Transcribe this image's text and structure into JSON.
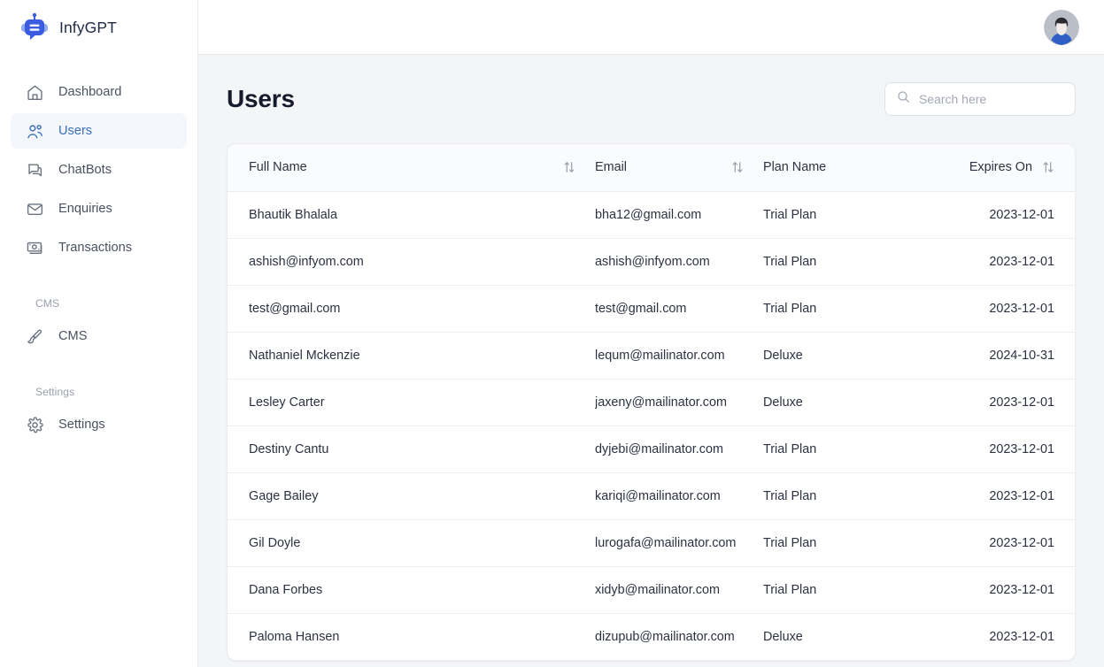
{
  "brand": {
    "name": "InfyGPT",
    "logo_icon": "chatbot-logo-icon",
    "accent": "#3a6fbe",
    "logo_color": "#3b5ce0"
  },
  "sidebar": {
    "items": [
      {
        "label": "Dashboard",
        "icon": "home-icon",
        "active": false
      },
      {
        "label": "Users",
        "icon": "users-icon",
        "active": true
      },
      {
        "label": "ChatBots",
        "icon": "chat-bubbles-icon",
        "active": false
      },
      {
        "label": "Enquiries",
        "icon": "envelope-icon",
        "active": false
      },
      {
        "label": "Transactions",
        "icon": "banknote-icon",
        "active": false
      }
    ],
    "sections": [
      {
        "label": "CMS",
        "items": [
          {
            "label": "CMS",
            "icon": "paintbrush-icon",
            "active": false
          }
        ]
      },
      {
        "label": "Settings",
        "items": [
          {
            "label": "Settings",
            "icon": "gear-icon",
            "active": false
          }
        ]
      }
    ]
  },
  "topbar": {
    "avatar_icon": "user-avatar-icon"
  },
  "page": {
    "title": "Users"
  },
  "search": {
    "placeholder": "Search here",
    "value": "",
    "icon": "search-icon"
  },
  "table": {
    "columns": [
      {
        "label": "Full Name",
        "sortable": true,
        "sort_icon": "sort-arrows-icon",
        "align": "left"
      },
      {
        "label": "Email",
        "sortable": true,
        "sort_icon": "sort-arrows-icon",
        "align": "left"
      },
      {
        "label": "Plan Name",
        "sortable": false,
        "align": "left"
      },
      {
        "label": "Expires On",
        "sortable": true,
        "sort_icon": "sort-arrows-icon",
        "align": "right"
      }
    ],
    "rows": [
      {
        "full_name": "Bhautik Bhalala",
        "email": "bha12@gmail.com",
        "plan_name": "Trial Plan",
        "expires_on": "2023-12-01"
      },
      {
        "full_name": "ashish@infyom.com",
        "email": "ashish@infyom.com",
        "plan_name": "Trial Plan",
        "expires_on": "2023-12-01"
      },
      {
        "full_name": "test@gmail.com",
        "email": "test@gmail.com",
        "plan_name": "Trial Plan",
        "expires_on": "2023-12-01"
      },
      {
        "full_name": "Nathaniel Mckenzie",
        "email": "lequm@mailinator.com",
        "plan_name": "Deluxe",
        "expires_on": "2024-10-31"
      },
      {
        "full_name": "Lesley Carter",
        "email": "jaxeny@mailinator.com",
        "plan_name": "Deluxe",
        "expires_on": "2023-12-01"
      },
      {
        "full_name": "Destiny Cantu",
        "email": "dyjebi@mailinator.com",
        "plan_name": "Trial Plan",
        "expires_on": "2023-12-01"
      },
      {
        "full_name": "Gage Bailey",
        "email": "kariqi@mailinator.com",
        "plan_name": "Trial Plan",
        "expires_on": "2023-12-01"
      },
      {
        "full_name": "Gil Doyle",
        "email": "lurogafa@mailinator.com",
        "plan_name": "Trial Plan",
        "expires_on": "2023-12-01"
      },
      {
        "full_name": "Dana Forbes",
        "email": "xidyb@mailinator.com",
        "plan_name": "Trial Plan",
        "expires_on": "2023-12-01"
      },
      {
        "full_name": "Paloma Hansen",
        "email": "dizupub@mailinator.com",
        "plan_name": "Deluxe",
        "expires_on": "2023-12-01"
      }
    ]
  }
}
